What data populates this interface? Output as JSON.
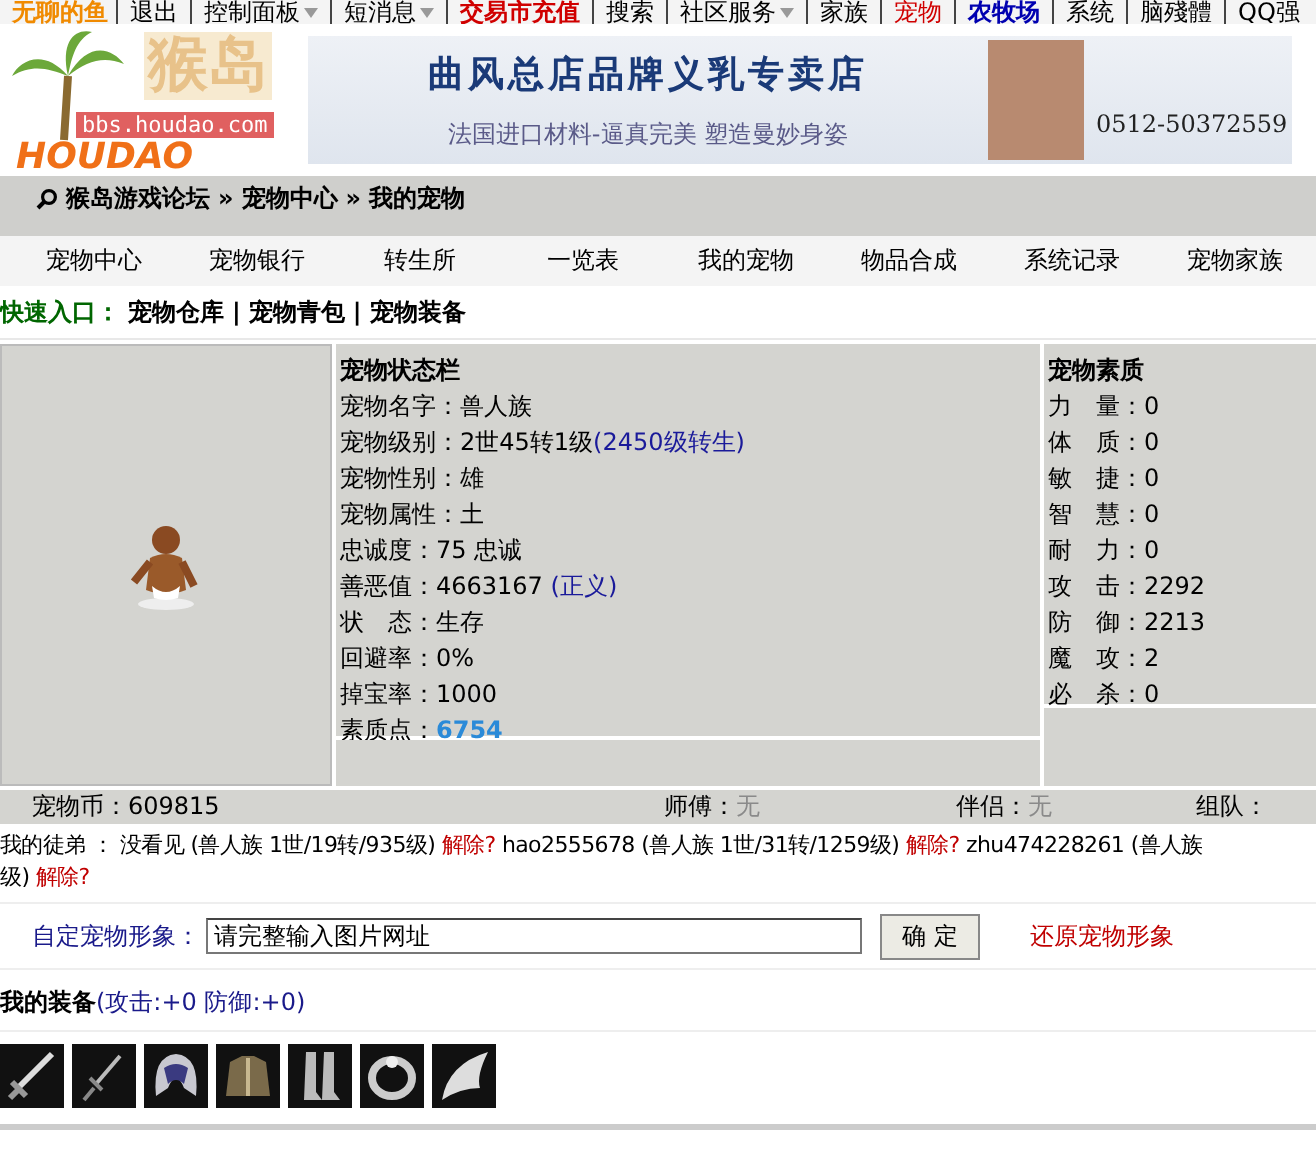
{
  "top_nav": {
    "username": "无聊的鱼",
    "items": [
      {
        "label": "退出",
        "kind": "plain",
        "dropdown": false
      },
      {
        "label": "控制面板",
        "kind": "plain",
        "dropdown": true
      },
      {
        "label": "短消息",
        "kind": "plain",
        "dropdown": true
      },
      {
        "label": "交易市充值",
        "kind": "hot",
        "dropdown": false
      },
      {
        "label": "搜索",
        "kind": "plain",
        "dropdown": false
      },
      {
        "label": "社区服务",
        "kind": "plain",
        "dropdown": true
      },
      {
        "label": "家族",
        "kind": "plain",
        "dropdown": false
      },
      {
        "label": "宠物",
        "kind": "current",
        "dropdown": false
      },
      {
        "label": "农牧场",
        "kind": "featured",
        "dropdown": false
      },
      {
        "label": "系统",
        "kind": "plain",
        "dropdown": false
      },
      {
        "label": "脑殘體",
        "kind": "plain",
        "dropdown": false
      },
      {
        "label": "QQ强",
        "kind": "plain",
        "dropdown": false
      }
    ]
  },
  "logo": {
    "title": "猴岛",
    "url": "bbs.houdao.com",
    "wordmark": "HOUDAO"
  },
  "banner": {
    "headline": "曲风总店品牌义乳专卖店",
    "tagline": "法国进口材料-逼真完美 塑造曼妙身姿",
    "phone": "0512-50372559"
  },
  "breadcrumb": {
    "separator": "»",
    "items": [
      "猴岛游戏论坛",
      "宠物中心",
      "我的宠物"
    ]
  },
  "tabs": [
    {
      "label": "宠物中心",
      "selected": false
    },
    {
      "label": "宠物银行",
      "selected": false
    },
    {
      "label": "转生所",
      "selected": false
    },
    {
      "label": "一览表",
      "selected": false
    },
    {
      "label": "我的宠物",
      "selected": false
    },
    {
      "label": "物品合成",
      "selected": false
    },
    {
      "label": "系统记录",
      "selected": false
    },
    {
      "label": "宠物家族",
      "selected": false
    }
  ],
  "quick_entry": {
    "label": "快速入口：",
    "separator": "|",
    "links": [
      "宠物仓库",
      "宠物青包",
      "宠物装备"
    ]
  },
  "status_panel": {
    "title": "宠物状态栏",
    "rows": [
      {
        "label": "宠物名字：",
        "value": "兽人族"
      },
      {
        "label": "宠物级别：",
        "value": "2世45转1级",
        "note": "(2450级转生)"
      },
      {
        "label": "宠物性别：",
        "value": "雄"
      },
      {
        "label": "宠物属性：",
        "value": "土"
      },
      {
        "label": "忠诚度：",
        "value": "75 忠诚"
      },
      {
        "label": "善恶值：",
        "value": "4663167 ",
        "note": "(正义)"
      },
      {
        "label": "状　态：",
        "value": "生存"
      },
      {
        "label": "回避率：",
        "value": "0%"
      },
      {
        "label": "掉宝率：",
        "value": "1000"
      },
      {
        "label": "素质点：",
        "value": "6754",
        "highlight": true
      }
    ]
  },
  "attributes_panel": {
    "title": "宠物素质",
    "rows": [
      {
        "label": "力　量：",
        "value": "0"
      },
      {
        "label": "体　质：",
        "value": "0"
      },
      {
        "label": "敏　捷：",
        "value": "0"
      },
      {
        "label": "智　慧：",
        "value": "0"
      },
      {
        "label": "耐　力：",
        "value": "0"
      },
      {
        "label": "攻　击：",
        "value": "2292"
      },
      {
        "label": "防　御：",
        "value": "2213"
      },
      {
        "label": "魔　攻：",
        "value": "2"
      },
      {
        "label": "必　杀：",
        "value": "0"
      }
    ]
  },
  "info_row": [
    {
      "label": "宠物币：",
      "value": "609815",
      "empty": false
    },
    {
      "label": "师傅：",
      "value": "无",
      "empty": true
    },
    {
      "label": "伴侣：",
      "value": "无",
      "empty": true
    },
    {
      "label": "组队："
    }
  ],
  "disciples": {
    "label": "我的徒弟 ：",
    "items": [
      {
        "name": "没看见",
        "info": "(兽人族 1世/19转/935级)",
        "action": "解除?"
      },
      {
        "name": "hao2555678",
        "info": "(兽人族 1世/31转/1259级)",
        "action": "解除?"
      },
      {
        "name": "zhu474228261",
        "info": "(兽人族",
        "info_tail": "级)",
        "action": "解除?"
      }
    ]
  },
  "custom_image": {
    "label": "自定宠物形象：",
    "value": "请完整输入图片网址",
    "button": "确 定",
    "reset": "还原宠物形象"
  },
  "equipment": {
    "title": "我的装备",
    "stats": "(攻击:+0 防御:+0)",
    "items": [
      {
        "kind": "sword"
      },
      {
        "kind": "dagger"
      },
      {
        "kind": "helmet"
      },
      {
        "kind": "armor"
      },
      {
        "kind": "boots"
      },
      {
        "kind": "ring"
      },
      {
        "kind": "wing"
      }
    ]
  }
}
